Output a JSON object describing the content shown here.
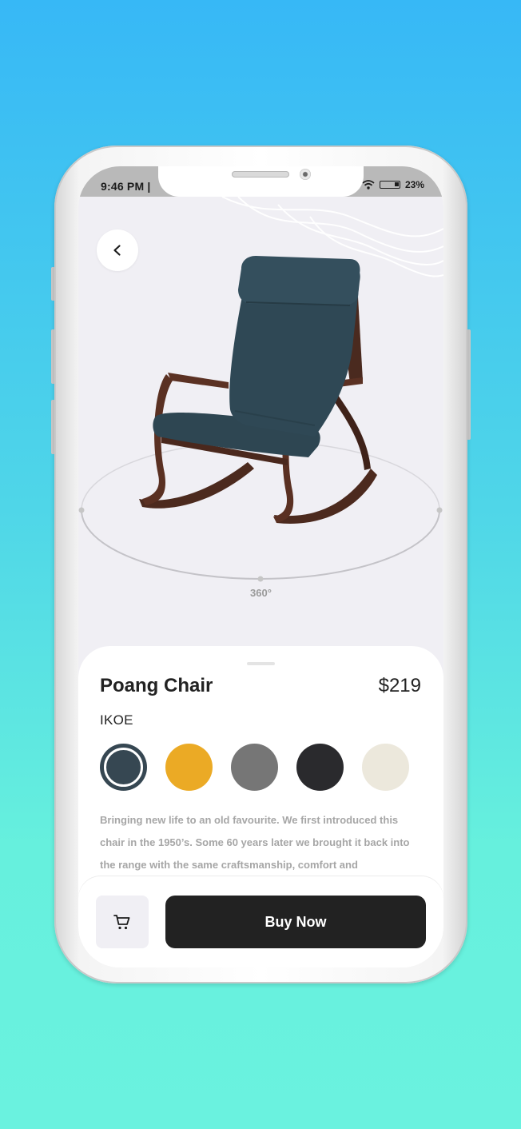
{
  "status_bar": {
    "time": "9:46 PM | ",
    "battery": "23%"
  },
  "product": {
    "name": "Poang Chair",
    "price": "$219",
    "brand": "IKOE",
    "rotation_label": "360°",
    "description": "Bringing new life to an old favourite. We first introduced this chair in the 1950’s. Some 60 years later we brought it back into the range with the same craftsmanship, comfort and",
    "colors": [
      {
        "name": "navy",
        "hex": "#364752",
        "selected": true
      },
      {
        "name": "mustard",
        "hex": "#ebaa25",
        "selected": false
      },
      {
        "name": "grey",
        "hex": "#767676",
        "selected": false
      },
      {
        "name": "charcoal",
        "hex": "#2a2a2d",
        "selected": false
      },
      {
        "name": "cream",
        "hex": "#ece8dc",
        "selected": false
      }
    ]
  },
  "actions": {
    "buy_label": "Buy Now",
    "back_icon": "chevron-left-icon",
    "cart_icon": "cart-icon"
  }
}
